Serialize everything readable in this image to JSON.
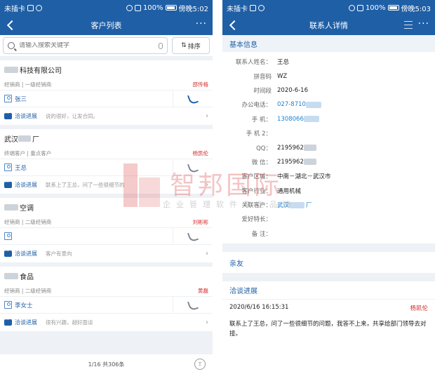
{
  "status_bar": {
    "left": {
      "carrier": "未插卡"
    },
    "right_left": {
      "battery": "100%",
      "carrier2": "傍晚5:02"
    },
    "right_right": {
      "battery": "100%",
      "time": "傍晚5:03"
    }
  },
  "left": {
    "title": "客户列表",
    "search": {
      "placeholder": "请输入搜索关键字"
    },
    "sort_label": "排序",
    "customers": [
      {
        "company_suffix": "科技有限公司",
        "tags": "经销商 | 一级经销商",
        "owner": "邵传格",
        "contact": "张三",
        "progress_label": "洽谈进展",
        "progress_text": "说的很好，让发合同。"
      },
      {
        "company_prefix": "武汉",
        "company_suffix": "厂",
        "tags": "终端客户 | 重点客户",
        "owner": "杨凯伦",
        "contact": "王总",
        "progress_label": "洽谈进展",
        "progress_text": "联系上了王总，问了一些很细节的"
      },
      {
        "company_suffix": "空调",
        "tags": "经销商 | 二级经销商",
        "owner": "刘彬彬",
        "contact": "",
        "progress_label": "洽谈进展",
        "progress_text": "客户有意向"
      },
      {
        "company_suffix": "食品",
        "tags": "经销商 | 二级经销商",
        "owner": "黄磊",
        "contact": "李女士",
        "progress_label": "洽谈进展",
        "progress_text": "很有兴趣，越好面谈"
      }
    ],
    "pager": "1/16 共306条",
    "top_btn": "T"
  },
  "right": {
    "title": "联系人详情",
    "section_basic": "基本信息",
    "fields": [
      {
        "k": "联系人姓名：",
        "v": "王总"
      },
      {
        "k": "拼音码",
        "v": "WZ"
      },
      {
        "k": "时间段",
        "v": "2020-6-16"
      },
      {
        "k": "办公电话：",
        "v": "027-8710"
      },
      {
        "k": "手  机：",
        "v": "1308066"
      },
      {
        "k": "手 机 2：",
        "v": ""
      },
      {
        "k": "QQ：",
        "v": "2195962"
      },
      {
        "k": "微  信：",
        "v": "2195962"
      },
      {
        "k": "客户区域：",
        "v": "中南－湖北－武汉市"
      },
      {
        "k": "客户行业：",
        "v": "通用机械"
      },
      {
        "k": "关联客户：",
        "v": "武汉"
      },
      {
        "k": "爱好特长：",
        "v": ""
      },
      {
        "k": "备    注：",
        "v": ""
      }
    ],
    "related_customer_suffix": "厂",
    "section_relatives": "亲友",
    "section_progress": "洽谈进展",
    "log": {
      "time": "2020/6/16 16:15:31",
      "owner": "杨凯伦",
      "text": "联系上了王总，问了一些很细节的问题，我答不上来，共享给部门领导去对接。"
    }
  },
  "watermark": {
    "title": "智邦国际",
    "subtitle": "企业管理软件专业品牌"
  },
  "colors": {
    "primary": "#1f5fa6",
    "link": "#1f7fd0",
    "owner": "#d62b2b"
  }
}
